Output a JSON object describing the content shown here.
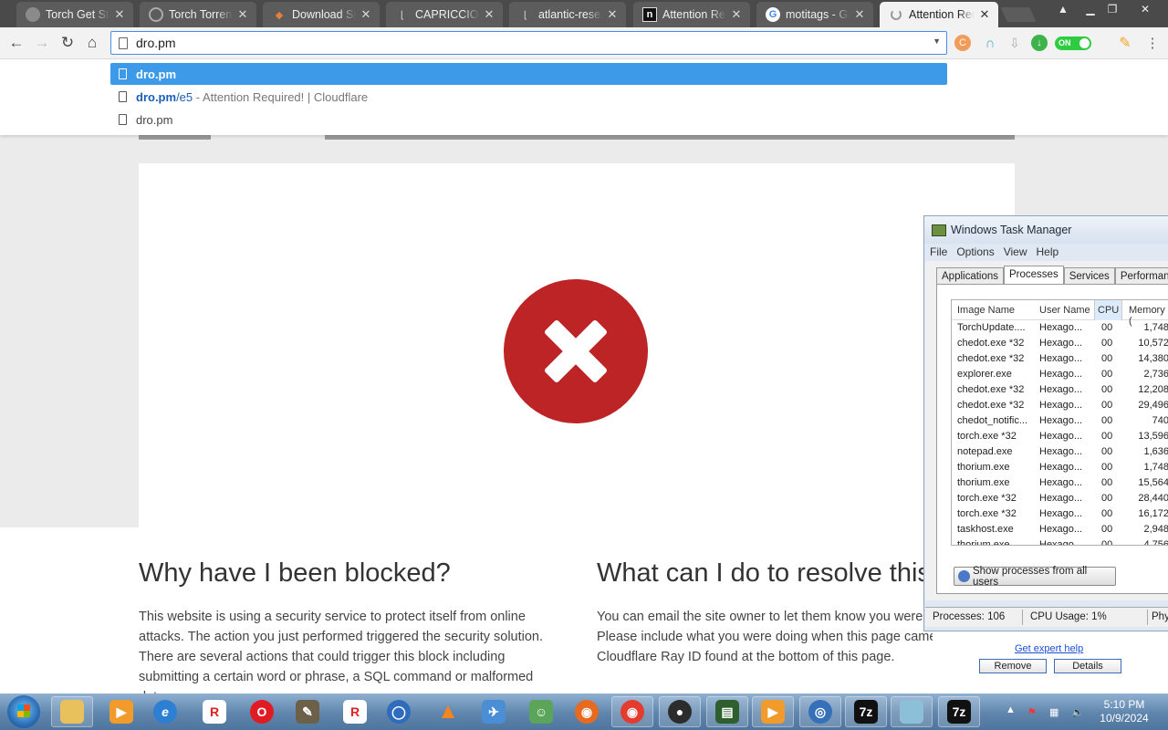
{
  "tabs": [
    {
      "title": "Torch Get Sta",
      "icon": "torch-icon"
    },
    {
      "title": "Torch Torrent",
      "icon": "torch-torrent-icon"
    },
    {
      "title": "Download Sm",
      "icon": "fox-icon"
    },
    {
      "title": "CAPRICCIO H",
      "icon": "document-icon"
    },
    {
      "title": "atlantic-resea",
      "icon": "document-icon"
    },
    {
      "title": "Attention Req",
      "icon": "n-logo-icon"
    },
    {
      "title": "motitags - Go",
      "icon": "google-icon"
    },
    {
      "title": "Attention Req",
      "icon": "loading-icon"
    }
  ],
  "toolbar": {
    "address": "dro.pm",
    "toggle_label": "ON"
  },
  "suggestions": [
    {
      "url": "dro.pm",
      "path": "",
      "rest": ""
    },
    {
      "url": "dro.pm",
      "path": "/e5",
      "rest": " - Attention Required! | Cloudflare"
    },
    {
      "url": "dro.pm",
      "path": "",
      "rest": ""
    }
  ],
  "page": {
    "heading_left": "Why have I been blocked?",
    "text_left": "This website is using a security service to protect itself from online attacks. The action you just performed triggered the security solution. There are several actions that could trigger this block including submitting a certain word or phrase, a SQL command or malformed data.",
    "heading_right": "What can I do to resolve this?",
    "text_right": "You can email the site owner to let them know you were blocked. Please include what you were doing when this page came up and the Cloudflare Ray ID found at the bottom of this page.",
    "error_color": "#bd2426"
  },
  "task_manager": {
    "title": "Windows Task Manager",
    "menu": [
      "File",
      "Options",
      "View",
      "Help"
    ],
    "tabs": [
      "Applications",
      "Processes",
      "Services",
      "Performance"
    ],
    "active_tab": "Processes",
    "columns": [
      "Image Name",
      "User Name",
      "CPU",
      "Memory ("
    ],
    "rows": [
      {
        "image": "TorchUpdate....",
        "user": "Hexago...",
        "cpu": "00",
        "mem": "1,748"
      },
      {
        "image": "chedot.exe *32",
        "user": "Hexago...",
        "cpu": "00",
        "mem": "10,572"
      },
      {
        "image": "chedot.exe *32",
        "user": "Hexago...",
        "cpu": "00",
        "mem": "14,380"
      },
      {
        "image": "explorer.exe",
        "user": "Hexago...",
        "cpu": "00",
        "mem": "2,736"
      },
      {
        "image": "chedot.exe *32",
        "user": "Hexago...",
        "cpu": "00",
        "mem": "12,208"
      },
      {
        "image": "chedot.exe *32",
        "user": "Hexago...",
        "cpu": "00",
        "mem": "29,496"
      },
      {
        "image": "chedot_notific...",
        "user": "Hexago...",
        "cpu": "00",
        "mem": "740"
      },
      {
        "image": "torch.exe *32",
        "user": "Hexago...",
        "cpu": "00",
        "mem": "13,596"
      },
      {
        "image": "notepad.exe",
        "user": "Hexago...",
        "cpu": "00",
        "mem": "1,636"
      },
      {
        "image": "thorium.exe",
        "user": "Hexago...",
        "cpu": "00",
        "mem": "1,748"
      },
      {
        "image": "thorium.exe",
        "user": "Hexago...",
        "cpu": "00",
        "mem": "15,564"
      },
      {
        "image": "torch.exe *32",
        "user": "Hexago...",
        "cpu": "00",
        "mem": "28,440"
      },
      {
        "image": "torch.exe *32",
        "user": "Hexago...",
        "cpu": "00",
        "mem": "16,172"
      },
      {
        "image": "taskhost.exe",
        "user": "Hexago...",
        "cpu": "00",
        "mem": "2,948"
      },
      {
        "image": "thorium.exe",
        "user": "Hexago...",
        "cpu": "00",
        "mem": "4,756"
      }
    ],
    "show_all": "Show processes from all users",
    "status": {
      "processes": "Processes: 106",
      "cpu": "CPU Usage: 1%",
      "phys": "Phy"
    },
    "expert_link": "Get expert help",
    "remove_label": "Remove",
    "details_label": "Details"
  },
  "taskbar": {
    "time": "5:10 PM",
    "date": "10/9/2024",
    "apps": [
      "explorer-icon",
      "media-player-icon",
      "ie-icon",
      "roblox-icon",
      "opera-icon",
      "gimp-icon",
      "roblox-studio-icon",
      "torch-browser-icon",
      "vlc-icon",
      "bird-icon",
      "users-icon",
      "firefox-icon",
      "firefox-nightly-icon",
      "angry-bird-icon",
      "terminal-icon",
      "media-icon",
      "globe-icon",
      "7zip-icon",
      "files-icon",
      "7zip-file-manager-icon"
    ]
  }
}
